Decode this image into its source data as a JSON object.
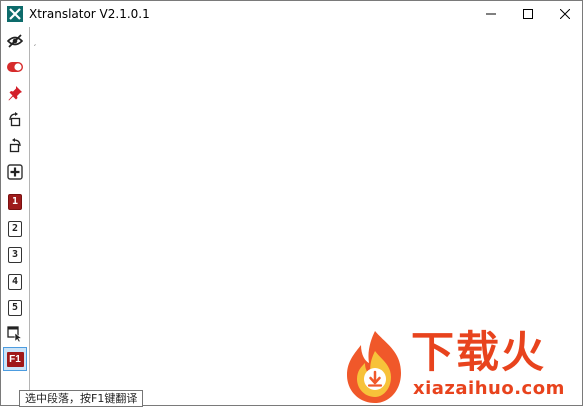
{
  "window": {
    "title": "Xtranslator V2.1.0.1",
    "icons": {
      "app": "xtranslator-logo-icon",
      "minimize": "minimize-icon",
      "maximize": "maximize-icon",
      "close": "close-icon"
    }
  },
  "sidebar": {
    "tools": [
      {
        "id": "visibility",
        "icon": "eye-slash-icon"
      },
      {
        "id": "toggle",
        "icon": "toggle-switch-icon",
        "state": "on"
      },
      {
        "id": "pin",
        "icon": "pin-icon"
      },
      {
        "id": "rotate-right",
        "icon": "rotate-clockwise-icon"
      },
      {
        "id": "rotate-left",
        "icon": "rotate-counterclockwise-icon"
      },
      {
        "id": "add",
        "icon": "plus-box-icon"
      }
    ],
    "number_buttons": [
      "1",
      "2",
      "3",
      "4",
      "5"
    ],
    "active_number": "1",
    "select_window_icon": "window-pointer-icon",
    "f1_label": "F1"
  },
  "content": {
    "caret": "′"
  },
  "tooltip": {
    "text": "选中段落，按F1键翻译"
  },
  "watermark": {
    "brand_cn": "下载火",
    "url": "xiazaihuo.com",
    "logo_icon": "flame-download-icon"
  },
  "colors": {
    "accent_red": "#9e1b1b",
    "watermark_orange": "#e8431d",
    "selection_blue": "#cce4f7"
  }
}
